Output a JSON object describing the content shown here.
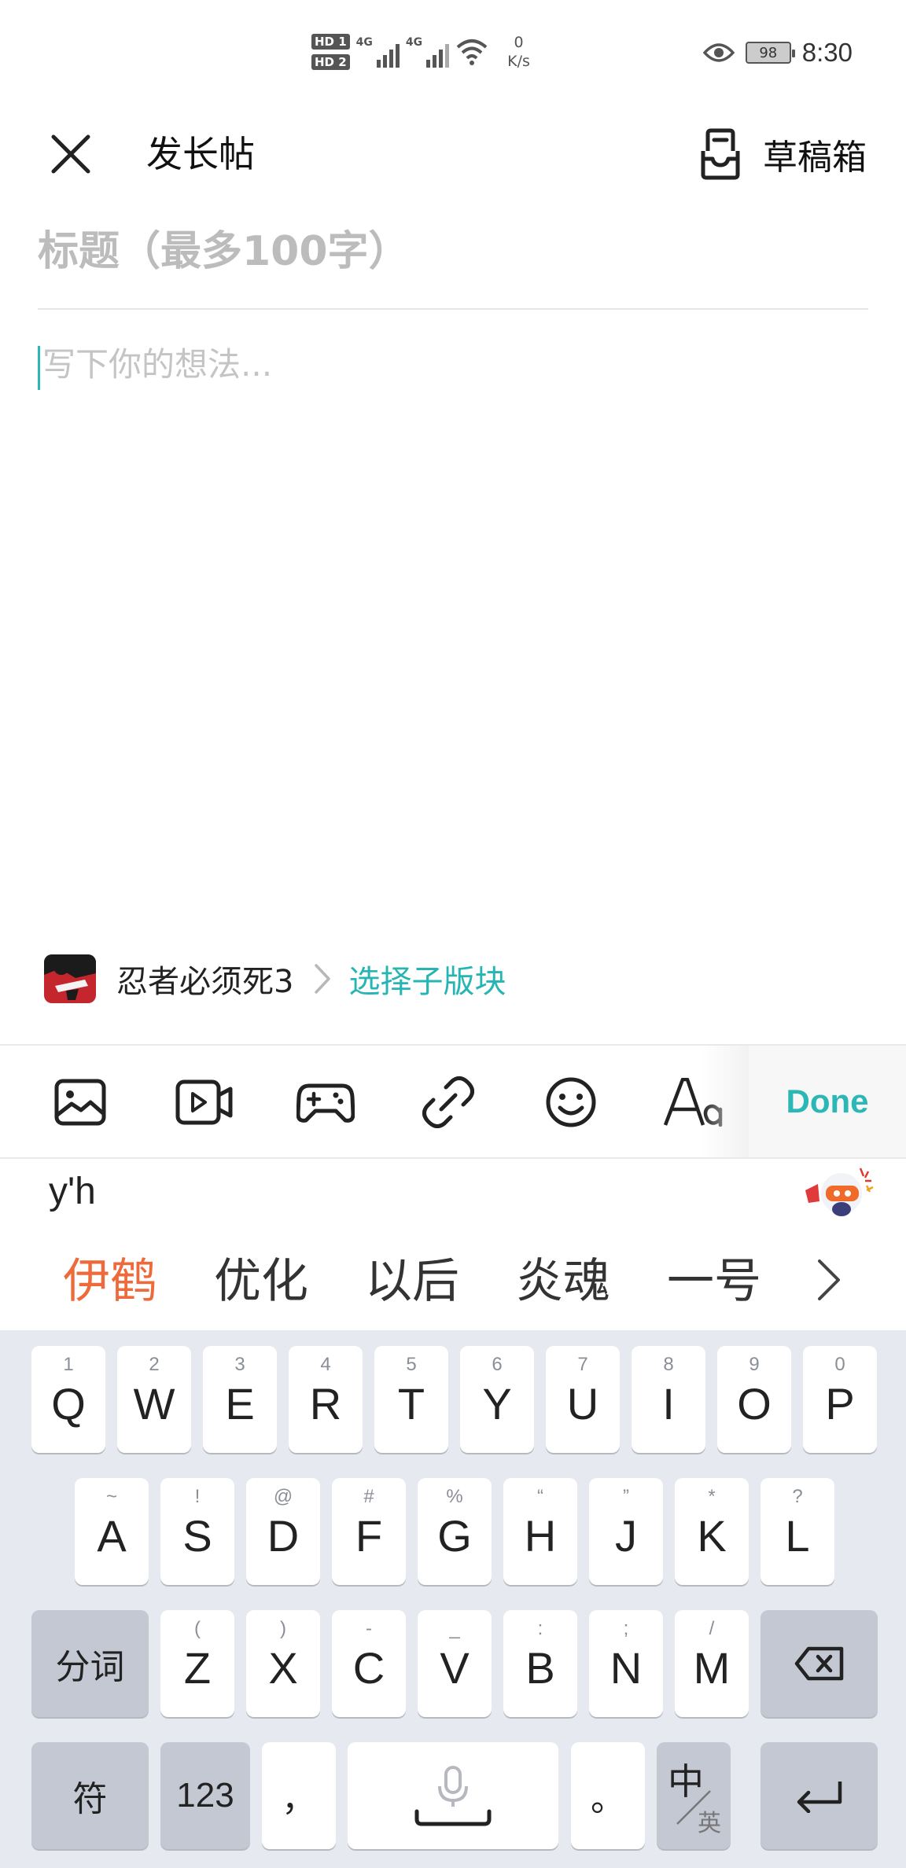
{
  "status_bar": {
    "hd1": "HD 1",
    "hd2": "HD 2",
    "sim1_network": "4G",
    "sim2_network": "4G",
    "speed_value": "0",
    "speed_unit": "K/s",
    "battery": "98",
    "time": "8:30",
    "icons": [
      "signal-icon",
      "wifi-icon",
      "eye-icon",
      "battery-icon"
    ]
  },
  "header": {
    "title": "发长帖",
    "drafts_label": "草稿箱",
    "icons": [
      "close-icon",
      "drafts-icon"
    ]
  },
  "editor": {
    "title_placeholder": "标题（最多100字）",
    "body_placeholder": "写下你的想法..."
  },
  "forum": {
    "name": "忍者必须死3",
    "subforum_label": "选择子版块"
  },
  "toolbar": {
    "icons": [
      "image-icon",
      "video-icon",
      "gamepad-icon",
      "link-icon",
      "emoji-icon",
      "text-format-icon"
    ],
    "done_label": "Done"
  },
  "ime": {
    "pinyin": "y'h",
    "candidates": [
      "伊鹤",
      "优化",
      "以后",
      "炎魂",
      "一号"
    ]
  },
  "keyboard": {
    "row1": [
      {
        "key": "Q",
        "hint": "1"
      },
      {
        "key": "W",
        "hint": "2"
      },
      {
        "key": "E",
        "hint": "3"
      },
      {
        "key": "R",
        "hint": "4"
      },
      {
        "key": "T",
        "hint": "5"
      },
      {
        "key": "Y",
        "hint": "6"
      },
      {
        "key": "U",
        "hint": "7"
      },
      {
        "key": "I",
        "hint": "8"
      },
      {
        "key": "O",
        "hint": "9"
      },
      {
        "key": "P",
        "hint": "0"
      }
    ],
    "row2": [
      {
        "key": "A",
        "hint": "~"
      },
      {
        "key": "S",
        "hint": "!"
      },
      {
        "key": "D",
        "hint": "@"
      },
      {
        "key": "F",
        "hint": "#"
      },
      {
        "key": "G",
        "hint": "%"
      },
      {
        "key": "H",
        "hint": "“"
      },
      {
        "key": "J",
        "hint": "”"
      },
      {
        "key": "K",
        "hint": "*"
      },
      {
        "key": "L",
        "hint": "?"
      }
    ],
    "row3": [
      {
        "key": "Z",
        "hint": "("
      },
      {
        "key": "X",
        "hint": ")"
      },
      {
        "key": "C",
        "hint": "-"
      },
      {
        "key": "V",
        "hint": "_"
      },
      {
        "key": "B",
        "hint": ":"
      },
      {
        "key": "N",
        "hint": ";"
      },
      {
        "key": "M",
        "hint": "/"
      }
    ],
    "segment_label": "分词",
    "symbols_label": "符",
    "numbers_label": "123",
    "comma": "，",
    "period": "。",
    "lang_primary": "中",
    "lang_secondary": "英"
  }
}
